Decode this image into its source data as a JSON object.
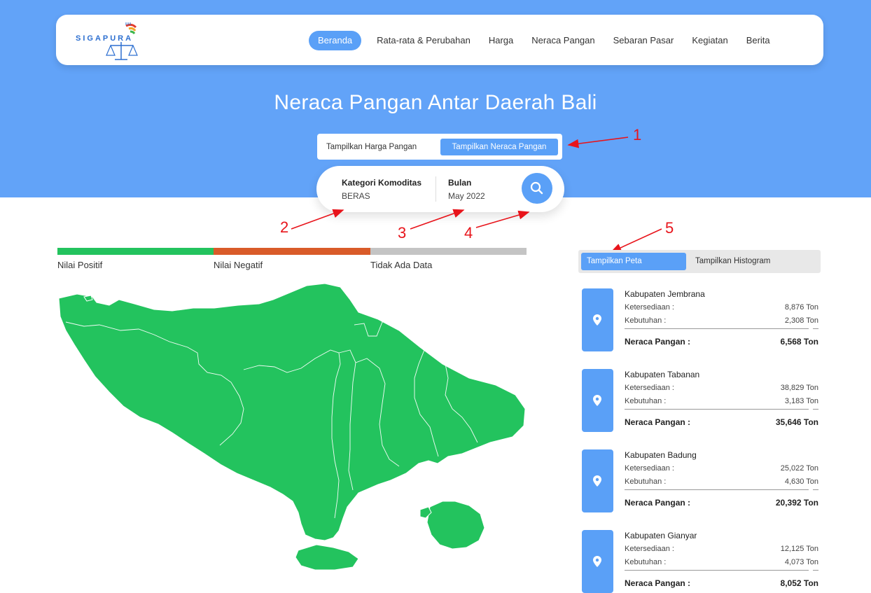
{
  "nav": {
    "logo_text": "SIGAPURA",
    "items": [
      {
        "label": "Beranda",
        "active": true
      },
      {
        "label": "Rata-rata & Perubahan",
        "active": false
      },
      {
        "label": "Harga",
        "active": false
      },
      {
        "label": "Neraca Pangan",
        "active": false
      },
      {
        "label": "Sebaran Pasar",
        "active": false
      },
      {
        "label": "Kegiatan",
        "active": false
      },
      {
        "label": "Berita",
        "active": false
      }
    ]
  },
  "hero": {
    "title": "Neraca Pangan Antar Daerah Bali",
    "toggle": {
      "option1": "Tampilkan Harga Pangan",
      "option2": "Tampilkan Neraca Pangan",
      "selected": "option2"
    },
    "search": {
      "category_label": "Kategori Komoditas",
      "category_value": "BERAS",
      "month_label": "Bulan",
      "month_value": "May 2022",
      "button_icon": "search-icon"
    }
  },
  "annotations": [
    "1",
    "2",
    "3",
    "4",
    "5"
  ],
  "legend": {
    "items": [
      {
        "label": "Nilai Positif",
        "color": "#23c35e"
      },
      {
        "label": "Nilai Negatif",
        "color": "#d95b29"
      },
      {
        "label": "Tidak Ada Data",
        "color": "#c4c4c4"
      }
    ]
  },
  "map": {
    "fill": "#23c35e",
    "border": "#ffffff",
    "region": "Bali"
  },
  "view_toggle": {
    "option1": "Tampilkan Peta",
    "option2": "Tampilkan Histogram",
    "selected": "option1"
  },
  "cards_labels": {
    "supply": "Ketersediaan :",
    "demand": "Kebutuhan :",
    "balance": "Neraca Pangan :"
  },
  "cards": [
    {
      "name": "Kabupaten Jembrana",
      "supply": "8,876 Ton",
      "demand": "2,308 Ton",
      "balance": "6,568 Ton"
    },
    {
      "name": "Kabupaten Tabanan",
      "supply": "38,829 Ton",
      "demand": "3,183 Ton",
      "balance": "35,646 Ton"
    },
    {
      "name": "Kabupaten Badung",
      "supply": "25,022 Ton",
      "demand": "4,630 Ton",
      "balance": "20,392 Ton"
    },
    {
      "name": "Kabupaten Gianyar",
      "supply": "12,125 Ton",
      "demand": "4,073 Ton",
      "balance": "8,052 Ton"
    }
  ],
  "colors": {
    "hero_bg": "#62a3f8",
    "accent": "#5aa0f7",
    "annotation": "#e8141b"
  }
}
